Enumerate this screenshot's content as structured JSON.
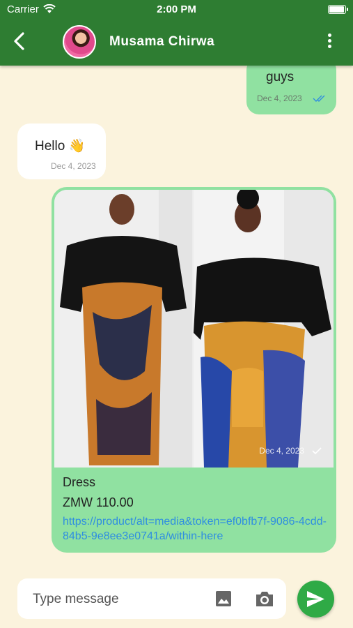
{
  "status_bar": {
    "carrier": "Carrier",
    "time": "2:00 PM",
    "battery_level": 1.0
  },
  "header": {
    "contact_name": "Musama Chirwa"
  },
  "messages": {
    "outgoing_text": {
      "text": "guys",
      "time": "Dec 4, 2023",
      "status": "read"
    },
    "incoming_text": {
      "text": "Hello 👋",
      "time": "Dec 4, 2023"
    },
    "product": {
      "title": "Dress",
      "price": "ZMW 110.00",
      "link": "https://product/alt=media&token=ef0bfb7f-9086-4cdd-84b5-9e8ee3e0741a/within-here",
      "time": "Dec 4, 2023",
      "status": "sent"
    }
  },
  "composer": {
    "placeholder": "Type message"
  },
  "colors": {
    "header": "#2e7d32",
    "background": "#fbf3dd",
    "outgoing_bubble": "#90e1a1",
    "incoming_bubble": "#ffffff",
    "send_button": "#2faa46",
    "link": "#2f8ee0"
  },
  "icons": [
    "wifi-icon",
    "battery-icon",
    "back-arrow-icon",
    "more-vert-icon",
    "double-check-icon",
    "check-icon",
    "image-icon",
    "camera-icon",
    "send-icon"
  ]
}
